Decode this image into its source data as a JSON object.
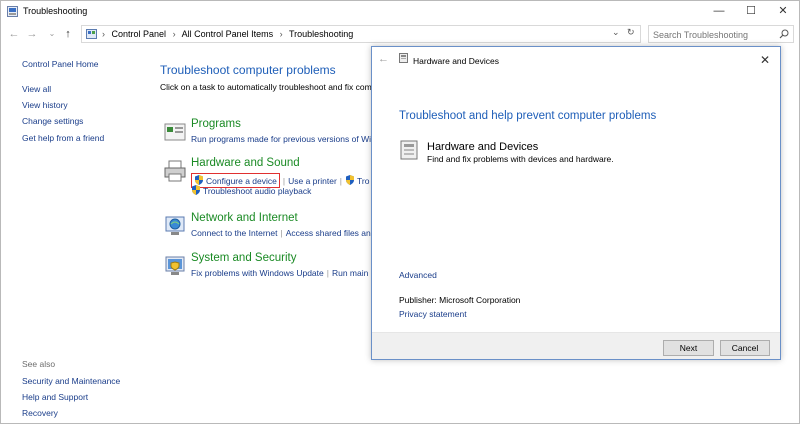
{
  "window": {
    "title": "Troubleshooting"
  },
  "address": {
    "crumbs": [
      "Control Panel",
      "All Control Panel Items",
      "Troubleshooting"
    ],
    "search_placeholder": "Search Troubleshooting"
  },
  "sidebar": {
    "home": "Control Panel Home",
    "links": [
      "View all",
      "View history",
      "Change settings",
      "Get help from a friend"
    ],
    "see_also_label": "See also",
    "see_also": [
      "Security and Maintenance",
      "Help and Support",
      "Recovery"
    ]
  },
  "main": {
    "heading": "Troubleshoot computer problems",
    "intro": "Click on a task to automatically troubleshoot and fix com",
    "categories": [
      {
        "title": "Programs",
        "links": [
          "Run programs made for previous versions of Wi"
        ]
      },
      {
        "title": "Hardware and Sound",
        "links": [
          "Configure a device",
          "Use a printer",
          "Tro",
          "Troubleshoot audio playback"
        ]
      },
      {
        "title": "Network and Internet",
        "links": [
          "Connect to the Internet",
          "Access shared files an"
        ]
      },
      {
        "title": "System and Security",
        "links": [
          "Fix problems with Windows Update",
          "Run main"
        ]
      }
    ]
  },
  "dialog": {
    "title": "Hardware and Devices",
    "heading": "Troubleshoot and help prevent computer problems",
    "item_title": "Hardware and Devices",
    "item_desc": "Find and fix problems with devices and hardware.",
    "advanced": "Advanced",
    "publisher": "Publisher:  Microsoft Corporation",
    "privacy": "Privacy statement",
    "next": "Next",
    "cancel": "Cancel"
  }
}
